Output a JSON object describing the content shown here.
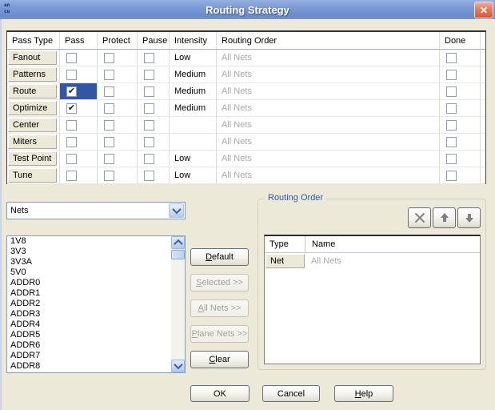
{
  "window": {
    "title": "Routing Strategy",
    "close_glyph": "✕",
    "icon_top": "an",
    "icon_bottom": "cu"
  },
  "pass_table": {
    "headers": [
      "Pass Type",
      "Pass",
      "Protect",
      "Pause",
      "Intensity",
      "Routing Order",
      "Done"
    ],
    "rows": [
      {
        "name": "Fanout",
        "pass": false,
        "pass_selected": false,
        "protect": false,
        "pause": false,
        "intensity": "Low",
        "routing_order": "All Nets",
        "done": false
      },
      {
        "name": "Patterns",
        "pass": false,
        "pass_selected": false,
        "protect": false,
        "pause": false,
        "intensity": "Medium",
        "routing_order": "All Nets",
        "done": false
      },
      {
        "name": "Route",
        "pass": true,
        "pass_selected": true,
        "protect": false,
        "pause": false,
        "intensity": "Medium",
        "routing_order": "All Nets",
        "done": false
      },
      {
        "name": "Optimize",
        "pass": true,
        "pass_selected": false,
        "protect": false,
        "pause": false,
        "intensity": "Medium",
        "routing_order": "All Nets",
        "done": false
      },
      {
        "name": "Center",
        "pass": false,
        "pass_selected": false,
        "protect": false,
        "pause": false,
        "intensity": "",
        "routing_order": "All Nets",
        "done": false
      },
      {
        "name": "Miters",
        "pass": false,
        "pass_selected": false,
        "protect": false,
        "pause": false,
        "intensity": "",
        "routing_order": "All Nets",
        "done": false
      },
      {
        "name": "Test Point",
        "pass": false,
        "pass_selected": false,
        "protect": false,
        "pause": false,
        "intensity": "Low",
        "routing_order": "All Nets",
        "done": false
      },
      {
        "name": "Tune",
        "pass": false,
        "pass_selected": false,
        "protect": false,
        "pause": false,
        "intensity": "Low",
        "routing_order": "All Nets",
        "done": false
      }
    ]
  },
  "nets_combo": {
    "value": "Nets"
  },
  "nets_list": [
    "1V8",
    "3V3",
    "3V3A",
    "5V0",
    "ADDR0",
    "ADDR1",
    "ADDR2",
    "ADDR3",
    "ADDR4",
    "ADDR5",
    "ADDR6",
    "ADDR7",
    "ADDR8"
  ],
  "action_buttons": [
    {
      "id": "default",
      "pre": "",
      "key": "D",
      "rest": "efault",
      "enabled": true
    },
    {
      "id": "selected",
      "pre": "",
      "key": "S",
      "rest": "elected >>",
      "enabled": false
    },
    {
      "id": "all-nets",
      "pre": "",
      "key": "A",
      "rest": "ll Nets >>",
      "enabled": false
    },
    {
      "id": "plane-nets",
      "pre": "",
      "key": "P",
      "rest": "lane Nets >>",
      "enabled": false
    },
    {
      "id": "clear",
      "pre": "",
      "key": "C",
      "rest": "lear",
      "enabled": true
    }
  ],
  "routing_order_group": {
    "title": "Routing Order",
    "icon_buttons": [
      "delete-icon",
      "move-up-icon",
      "move-down-icon"
    ],
    "table": {
      "headers": [
        "Type",
        "Name"
      ],
      "rows": [
        {
          "type": "Net",
          "name": "All Nets"
        }
      ]
    }
  },
  "dialog_buttons": [
    {
      "id": "ok",
      "pre": "OK",
      "key": "",
      "rest": ""
    },
    {
      "id": "cancel",
      "pre": "Cancel",
      "key": "",
      "rest": ""
    },
    {
      "id": "help",
      "pre": "",
      "key": "H",
      "rest": "elp"
    }
  ],
  "colors": {
    "dialog_bg": "#ECE9D8",
    "titlebar_blue": "#7A99D6",
    "selection_blue": "#3156A5",
    "grayed_text": "#A8A8A8",
    "group_label_blue": "#2D58B8",
    "close_red": "#D4573B"
  }
}
